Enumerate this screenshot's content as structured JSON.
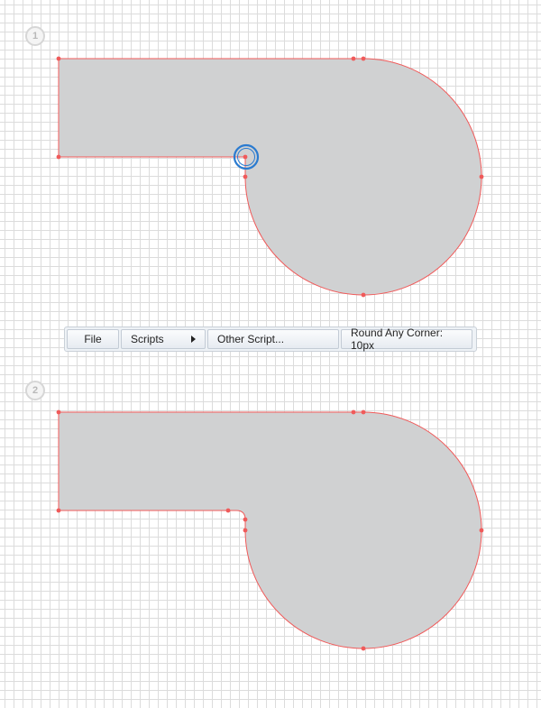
{
  "steps": {
    "step1_number": "1",
    "step2_number": "2"
  },
  "menu": {
    "file_label": "File",
    "scripts_label": "Scripts",
    "other_script_label": "Other Script...",
    "round_corner_label": "Round Any Corner: 10px",
    "submenu_icon": "chevron-right-icon"
  },
  "colors": {
    "shape_fill": "#d0d1d2",
    "path_stroke": "#f05a5a",
    "anchor_point": "#f05a5a",
    "selection_ring": "#2b7bd0",
    "grid_line": "#dcdcdc"
  }
}
